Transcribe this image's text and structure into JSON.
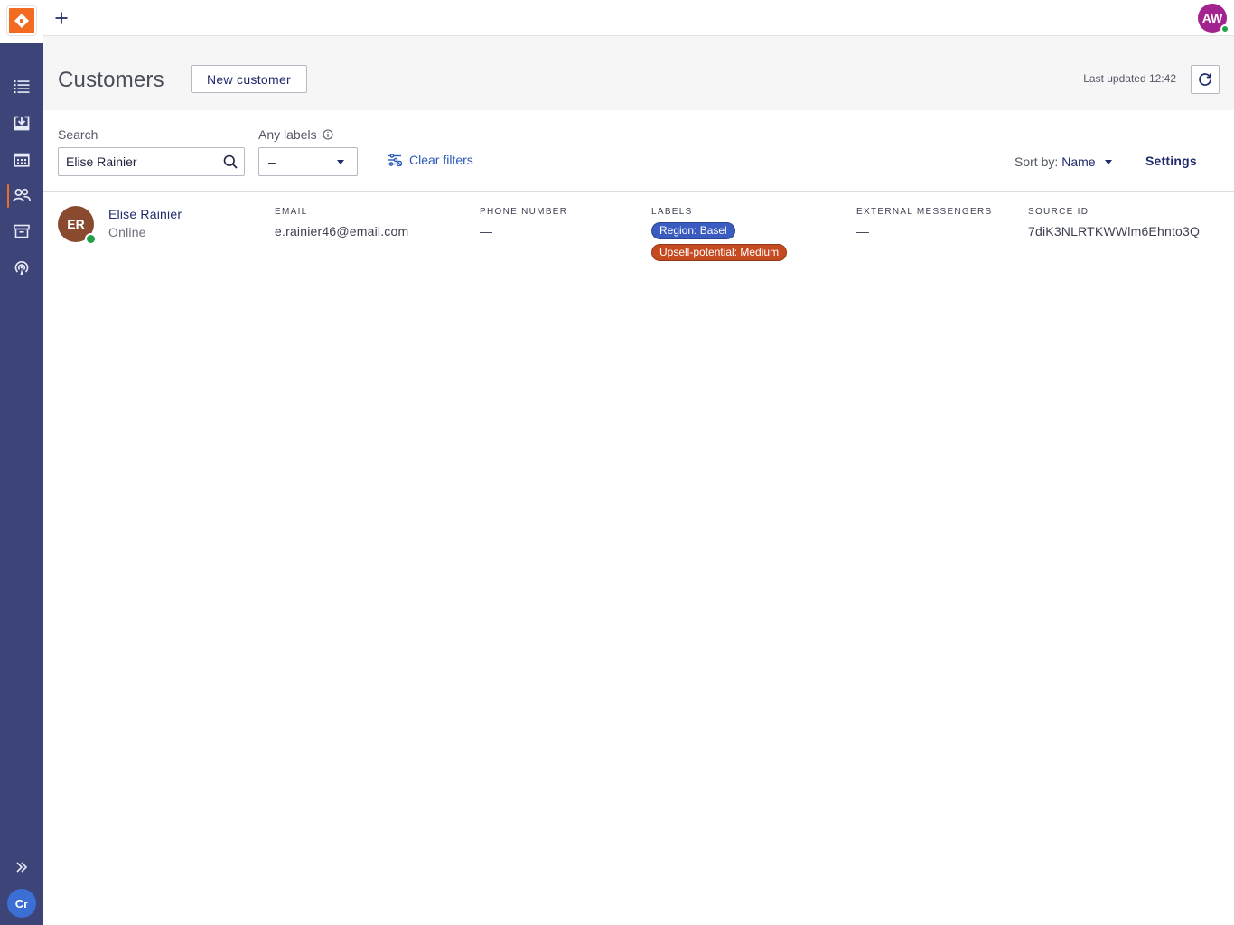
{
  "colors": {
    "sidebar": "#3d4478",
    "brand": "#f26b21",
    "link": "#2a59b8",
    "online": "#21a14a",
    "tag_region": "#3a5bbf",
    "tag_upsell": "#c64a20"
  },
  "sidebar": {
    "items": [
      {
        "icon": "list-icon"
      },
      {
        "icon": "inbox-icon"
      },
      {
        "icon": "calendar-icon"
      },
      {
        "icon": "users-icon",
        "active": true
      },
      {
        "icon": "archive-icon"
      },
      {
        "icon": "broadcast-icon"
      }
    ],
    "expand_icon": "double-chevron-right-icon",
    "user_initials": "Cr"
  },
  "topbar": {
    "add_icon": "plus-icon",
    "user_initials": "AW"
  },
  "header": {
    "title": "Customers",
    "new_button": "New customer",
    "last_updated": "Last updated 12:42",
    "refresh_icon": "refresh-icon"
  },
  "filters": {
    "search_label": "Search",
    "search_value": "Elise Rainier",
    "labels_label": "Any labels",
    "labels_value": "–",
    "clear_filters": "Clear filters",
    "sort_label": "Sort by:",
    "sort_value": "Name",
    "settings": "Settings"
  },
  "columns": {
    "email": "EMAIL",
    "phone": "PHONE NUMBER",
    "labels": "LABELS",
    "messengers": "EXTERNAL MESSENGERS",
    "source_id": "SOURCE ID"
  },
  "customers": [
    {
      "initials": "ER",
      "name": "Elise Rainier",
      "status": "Online",
      "email": "e.rainier46@email.com",
      "phone": "—",
      "labels": [
        "Region: Basel",
        "Upsell-potential: Medium"
      ],
      "messengers": "—",
      "source_id": "7diK3NLRTKWWlm6Ehnto3Q"
    }
  ]
}
